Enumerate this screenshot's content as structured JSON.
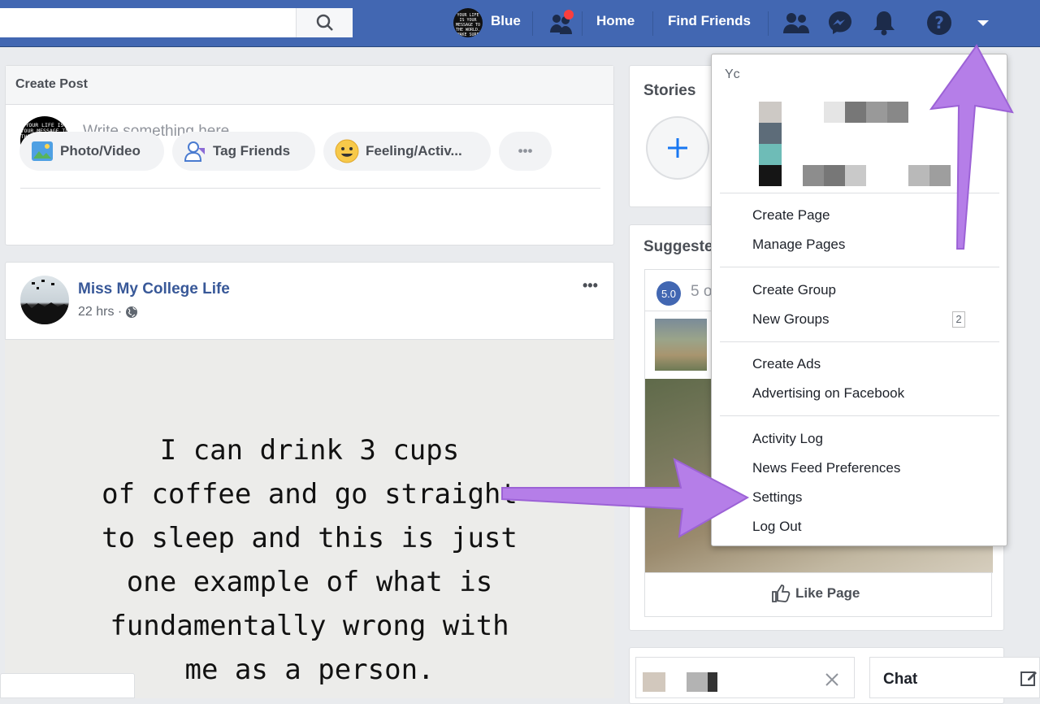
{
  "topbar": {
    "search_placeholder": "",
    "user_name": "Blue",
    "home": "Home",
    "find_friends": "Find Friends",
    "avatar_text": "YOUR LIFE IS YOUR MESSAGE TO THE WORLD. MAKE SURE IT'S INSPIRING"
  },
  "create_post": {
    "title": "Create Post",
    "placeholder": "Write something here...",
    "actions": [
      "Photo/Video",
      "Tag Friends",
      "Feeling/Activ...",
      "•••"
    ]
  },
  "post": {
    "author": "Miss My College Life",
    "time": "22 hrs ·",
    "more": "•••",
    "quote_lines": [
      "I can drink 3 cups",
      "of coffee and go straight",
      "to sleep and this is just",
      "one example of what is",
      "fundamentally wrong with",
      "me as a person."
    ]
  },
  "right": {
    "stories": "Stories",
    "suggested": "Suggeste",
    "rating": "5.0",
    "rating_text": "5 o",
    "like_page": "Like Page",
    "chat": "Chat"
  },
  "menu": {
    "header": "Yc",
    "items": [
      {
        "label": "Create Page"
      },
      {
        "label": "Manage Pages"
      },
      {
        "label": "Create Group"
      },
      {
        "label": "New Groups",
        "badge": "2"
      },
      {
        "label": "Create Ads"
      },
      {
        "label": "Advertising on Facebook"
      },
      {
        "label": "Activity Log"
      },
      {
        "label": "News Feed Preferences"
      },
      {
        "label": "Settings"
      },
      {
        "label": "Log Out"
      }
    ]
  },
  "colors": {
    "brand": "#4267b2",
    "arrow": "#b57ee8",
    "notification": "#fa3e3e"
  }
}
